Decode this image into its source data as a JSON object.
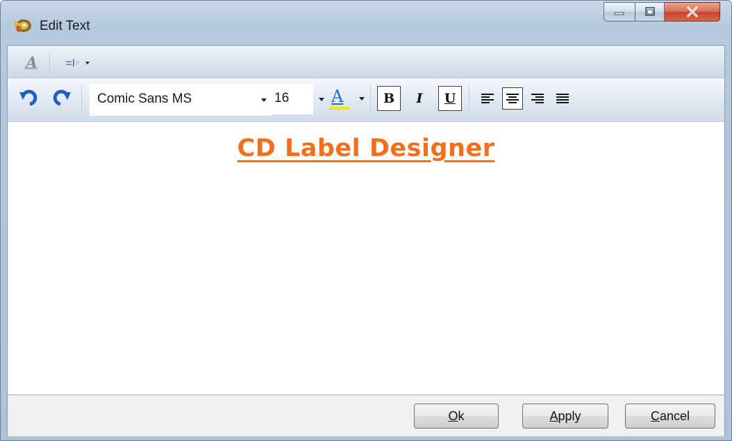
{
  "window": {
    "title": "Edit Text"
  },
  "toolbar_top": {
    "style_icon": "text-style-icon",
    "textbox_icon": "textbox-insert-icon"
  },
  "toolbar": {
    "undo_icon": "undo-icon",
    "redo_icon": "redo-icon",
    "font_family": "Comic Sans MS",
    "font_size": "16",
    "font_color_glyph": "A",
    "bold_glyph": "B",
    "italic_glyph": "I",
    "underline_glyph": "U",
    "bold_active": true,
    "italic_active": false,
    "underline_active": true,
    "alignment": "center",
    "font_color": "#1f6fd0",
    "font_color_swatch": "#f5e800"
  },
  "editor": {
    "text": "CD Label Designer",
    "text_color": "#f26f1b"
  },
  "footer": {
    "ok": {
      "underlined": "O",
      "rest": "k"
    },
    "apply": {
      "underlined": "A",
      "rest": "pply"
    },
    "cancel": {
      "underlined": "C",
      "rest": "ancel"
    }
  }
}
